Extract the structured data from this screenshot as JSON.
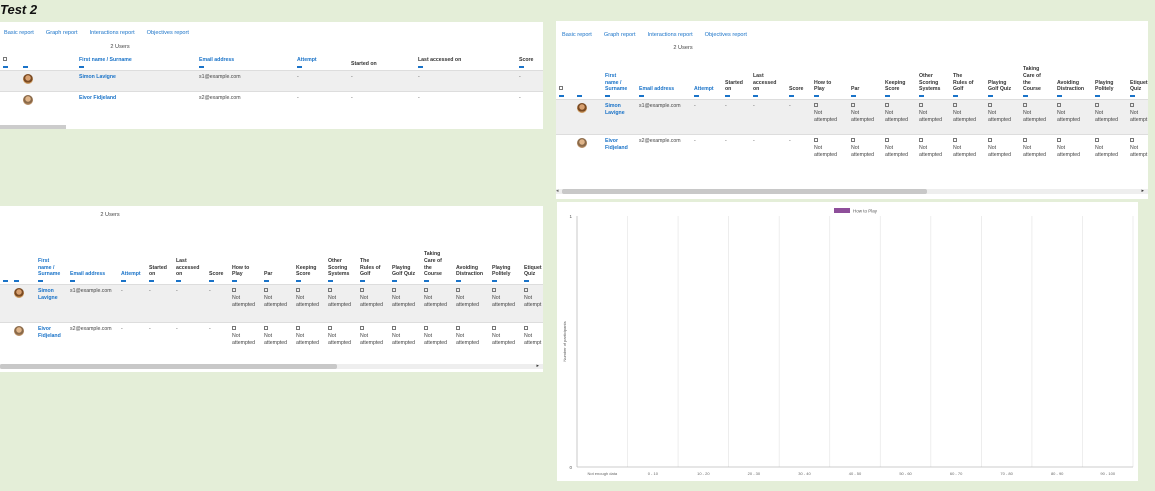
{
  "page_heading": "Test 2",
  "tabs": [
    "Basic report",
    "Graph report",
    "Interactions report",
    "Objectives report"
  ],
  "users_count": "2 Users",
  "short_columns": {
    "name": "First name / Surname",
    "email": "Email address",
    "attempt": "Attempt",
    "started": "Started on",
    "last": "Last accessed on",
    "score": "Score"
  },
  "wide_columns": {
    "first": "First",
    "name2": "name /",
    "surname": "Surname",
    "email": "Email address",
    "attempt": "Attempt",
    "started1": "Started",
    "started2": "on",
    "last1": "Last",
    "last2": "accessed",
    "last3": "on",
    "score": "Score",
    "activities": [
      [
        "How to",
        "Play"
      ],
      [
        "Par"
      ],
      [
        "Keeping",
        "Score"
      ],
      [
        "Other",
        "Scoring",
        "Systems"
      ],
      [
        "The",
        "Rules of",
        "Golf"
      ],
      [
        "Playing",
        "Golf Quiz"
      ],
      [
        "Taking",
        "Care of",
        "the",
        "Course"
      ],
      [
        "Avoiding",
        "Distraction"
      ],
      [
        "Playing",
        "Politely"
      ],
      [
        "Etiquet",
        "Quiz"
      ]
    ]
  },
  "users": [
    {
      "first": "Simon",
      "last": "Lavigne",
      "full": "Simon Lavigne",
      "email": "s1@example.com"
    },
    {
      "first": "Eivor",
      "last": "Fidjeland",
      "full": "Eivor Fidjeland",
      "email": "s2@example.com"
    }
  ],
  "dash": "-",
  "status_not": "Not",
  "status_attempted": "attempted",
  "status_attempted_trunc": "attempt",
  "chart_data": {
    "type": "bar",
    "legend": [
      "How to Play"
    ],
    "legend_position": "top",
    "series_color": "#8e4f9a",
    "ylabel": "Number of participants",
    "yticks": [
      "0",
      "1"
    ],
    "ylim": [
      0,
      1
    ],
    "categories": [
      "Not enough data",
      "0 - 10",
      "10 - 20",
      "20 - 30",
      "30 - 40",
      "40 - 50",
      "50 - 60",
      "60 - 70",
      "70 - 80",
      "80 - 90",
      "90 - 100"
    ],
    "series": [
      {
        "name": "How to Play",
        "values": [
          0,
          0,
          0,
          0,
          0,
          0,
          0,
          0,
          0,
          0,
          0
        ]
      }
    ],
    "grid": true
  }
}
